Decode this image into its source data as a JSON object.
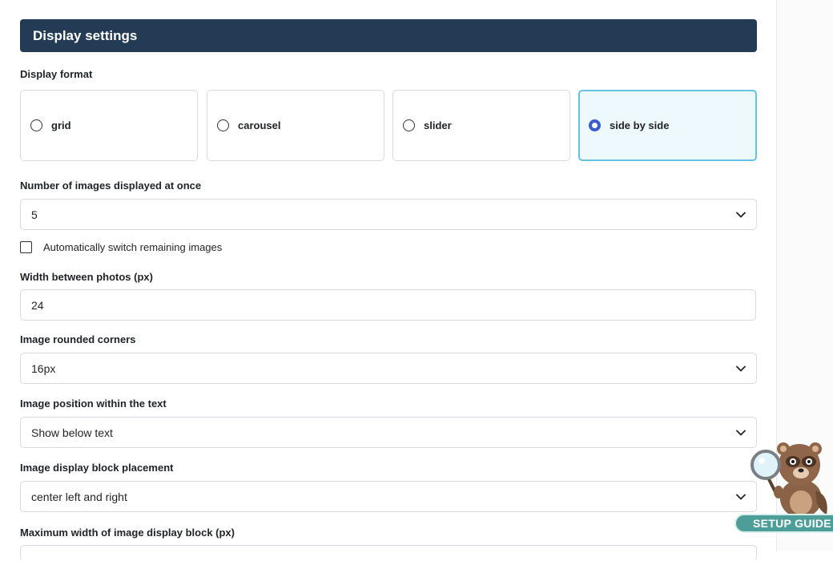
{
  "header": {
    "title": "Display settings"
  },
  "display_format": {
    "label": "Display format",
    "options": [
      {
        "label": "grid",
        "selected": false
      },
      {
        "label": "carousel",
        "selected": false
      },
      {
        "label": "slider",
        "selected": false
      },
      {
        "label": "side by side",
        "selected": true
      }
    ]
  },
  "images_count": {
    "label": "Number of images displayed at once",
    "value": "5"
  },
  "auto_switch": {
    "label": "Automatically switch remaining images",
    "checked": false
  },
  "width_between": {
    "label": "Width between photos (px)",
    "value": "24"
  },
  "rounded_corners": {
    "label": "Image rounded corners",
    "value": "16px"
  },
  "image_position": {
    "label": "Image position within the text",
    "value": "Show below text"
  },
  "block_placement": {
    "label": "Image display block placement",
    "value": "center left and right"
  },
  "max_width": {
    "label": "Maximum width of image display block (px)"
  },
  "setup_guide": {
    "label": "SETUP GUIDE M"
  },
  "colors": {
    "header_bg": "#233b54",
    "selected_border": "#66c2e3",
    "selected_bg": "#eef9fd",
    "radio_accent": "#3a5ccc",
    "guide_bg": "#4d9d99"
  }
}
